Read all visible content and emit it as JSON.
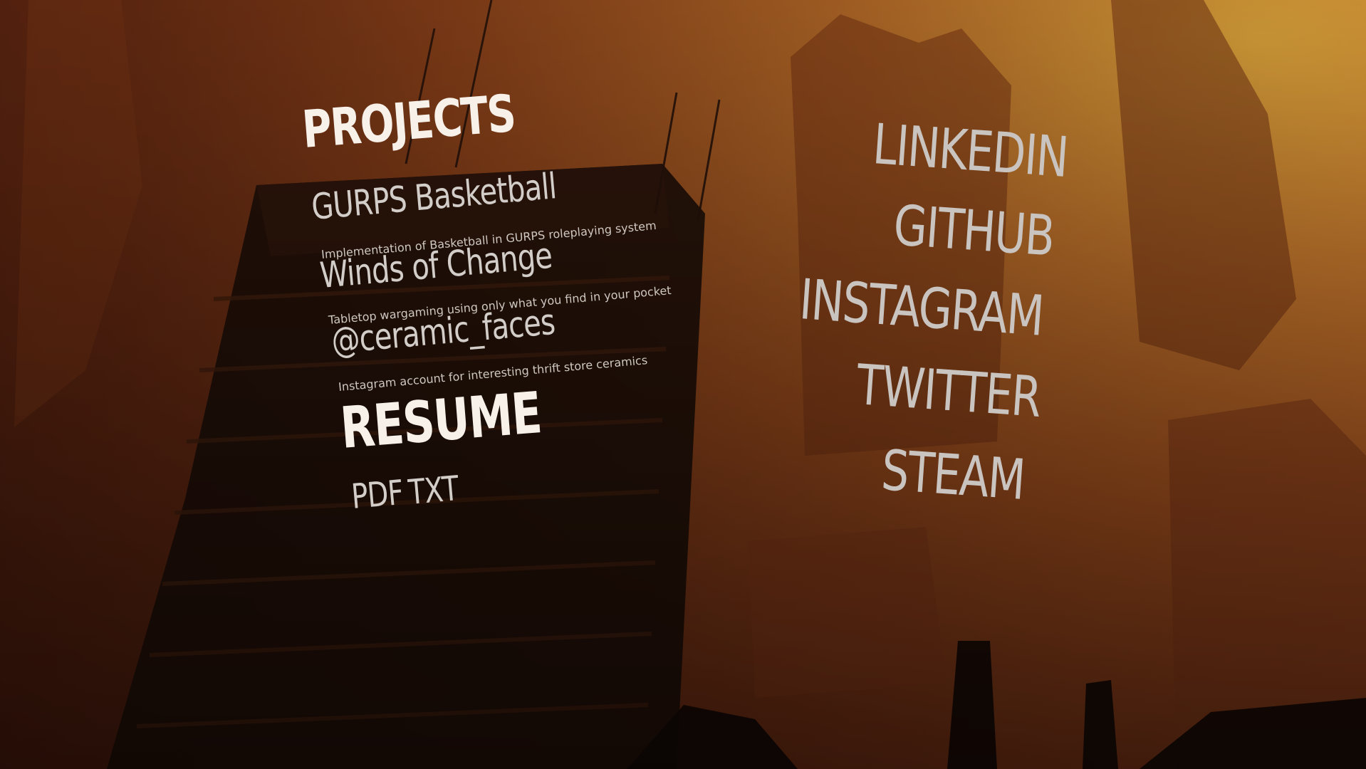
{
  "projects": {
    "heading": "PROJECTS",
    "items": [
      {
        "title": "GURPS Basketball",
        "description": "Implementation of Basketball in GURPS roleplaying system"
      },
      {
        "title": "Winds of Change",
        "description": "Tabletop wargaming using only what you find in your pocket"
      },
      {
        "title": "@ceramic_faces",
        "description": "Instagram account for interesting thrift store ceramics"
      }
    ]
  },
  "resume": {
    "heading": "RESUME",
    "pdf": "PDF",
    "txt": "TXT"
  },
  "social": {
    "linkedin": "LINKEDIN",
    "github": "GITHUB",
    "instagram": "INSTAGRAM",
    "twitter": "TWITTER",
    "steam": "STEAM"
  }
}
